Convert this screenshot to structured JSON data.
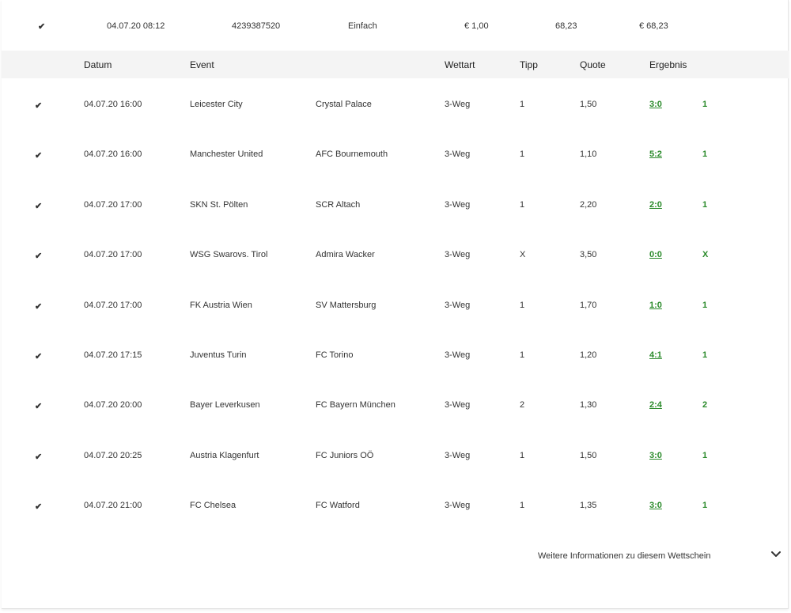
{
  "summary": {
    "date": "04.07.20 08:12",
    "ticket_id": "4239387520",
    "bet_type": "Einfach",
    "stake": "€ 1,00",
    "odds": "68,23",
    "payout": "€ 68,23"
  },
  "table": {
    "headers": {
      "datum": "Datum",
      "event": "Event",
      "wettart": "Wettart",
      "tipp": "Tipp",
      "quote": "Quote",
      "ergebnis": "Ergebnis"
    },
    "rows": [
      {
        "date": "04.07.20 16:00",
        "home": "Leicester City",
        "away": "Crystal Palace",
        "type": "3-Weg",
        "tip": "1",
        "odds": "1,50",
        "score": "3:0",
        "result": "1"
      },
      {
        "date": "04.07.20 16:00",
        "home": "Manchester United",
        "away": "AFC Bournemouth",
        "type": "3-Weg",
        "tip": "1",
        "odds": "1,10",
        "score": "5:2",
        "result": "1"
      },
      {
        "date": "04.07.20 17:00",
        "home": "SKN St. Pölten",
        "away": "SCR Altach",
        "type": "3-Weg",
        "tip": "1",
        "odds": "2,20",
        "score": "2:0",
        "result": "1"
      },
      {
        "date": "04.07.20 17:00",
        "home": "WSG Swarovs. Tirol",
        "away": "Admira Wacker",
        "type": "3-Weg",
        "tip": "X",
        "odds": "3,50",
        "score": "0:0",
        "result": "X"
      },
      {
        "date": "04.07.20 17:00",
        "home": "FK Austria Wien",
        "away": "SV Mattersburg",
        "type": "3-Weg",
        "tip": "1",
        "odds": "1,70",
        "score": "1:0",
        "result": "1"
      },
      {
        "date": "04.07.20 17:15",
        "home": "Juventus Turin",
        "away": "FC Torino",
        "type": "3-Weg",
        "tip": "1",
        "odds": "1,20",
        "score": "4:1",
        "result": "1"
      },
      {
        "date": "04.07.20 20:00",
        "home": "Bayer Leverkusen",
        "away": "FC Bayern München",
        "type": "3-Weg",
        "tip": "2",
        "odds": "1,30",
        "score": "2:4",
        "result": "2"
      },
      {
        "date": "04.07.20 20:25",
        "home": "Austria Klagenfurt",
        "away": "FC Juniors OÖ",
        "type": "3-Weg",
        "tip": "1",
        "odds": "1,50",
        "score": "3:0",
        "result": "1"
      },
      {
        "date": "04.07.20 21:00",
        "home": "FC Chelsea",
        "away": "FC Watford",
        "type": "3-Weg",
        "tip": "1",
        "odds": "1,35",
        "score": "3:0",
        "result": "1"
      }
    ]
  },
  "footer": {
    "more_info": "Weitere Informationen zu diesem Wettschein"
  },
  "icons": {
    "status": "check-icon",
    "expand": "chevron-down-icon"
  },
  "colors": {
    "success": "#2a9d2a",
    "header_bg": "#f4f4f4"
  }
}
